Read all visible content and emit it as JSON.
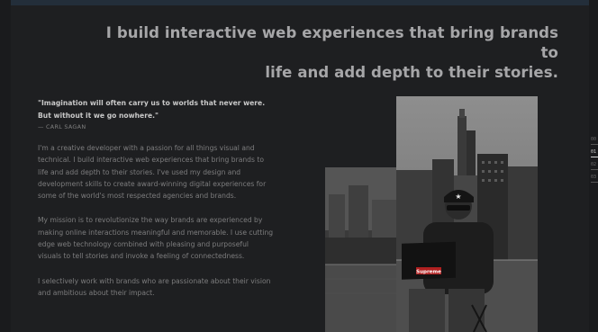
{
  "hero": {
    "headline_line1": "I build interactive web experiences that bring brands to",
    "headline_line2": "life and add depth to their stories."
  },
  "about": {
    "quote_line1": "\"Imagination will often carry us to worlds that never were.",
    "quote_line2": "But without it we go nowhere.\"",
    "quote_author": "— CARL SAGAN",
    "paragraphs": [
      "I'm a creative developer with a passion for all things visual and technical. I build interactive web experiences that bring brands to life and add depth to their stories. I've used my design and development skills to create award-winning digital experiences for some of the world's most respected agencies and brands.",
      "My mission is to revolutionize the way brands are experienced by making online interactions meaningful and memorable. I use cutting edge web technology combined with pleasing and purposeful visuals to tell stories and invoke a feeling of connectedness.",
      "I selectively work with brands who are passionate about their vision and ambitious about their impact."
    ]
  },
  "photo": {
    "laptop_logo": "Supreme"
  },
  "slide_nav": {
    "items": [
      "00",
      "01",
      "02",
      "03"
    ],
    "active_index": 1
  }
}
